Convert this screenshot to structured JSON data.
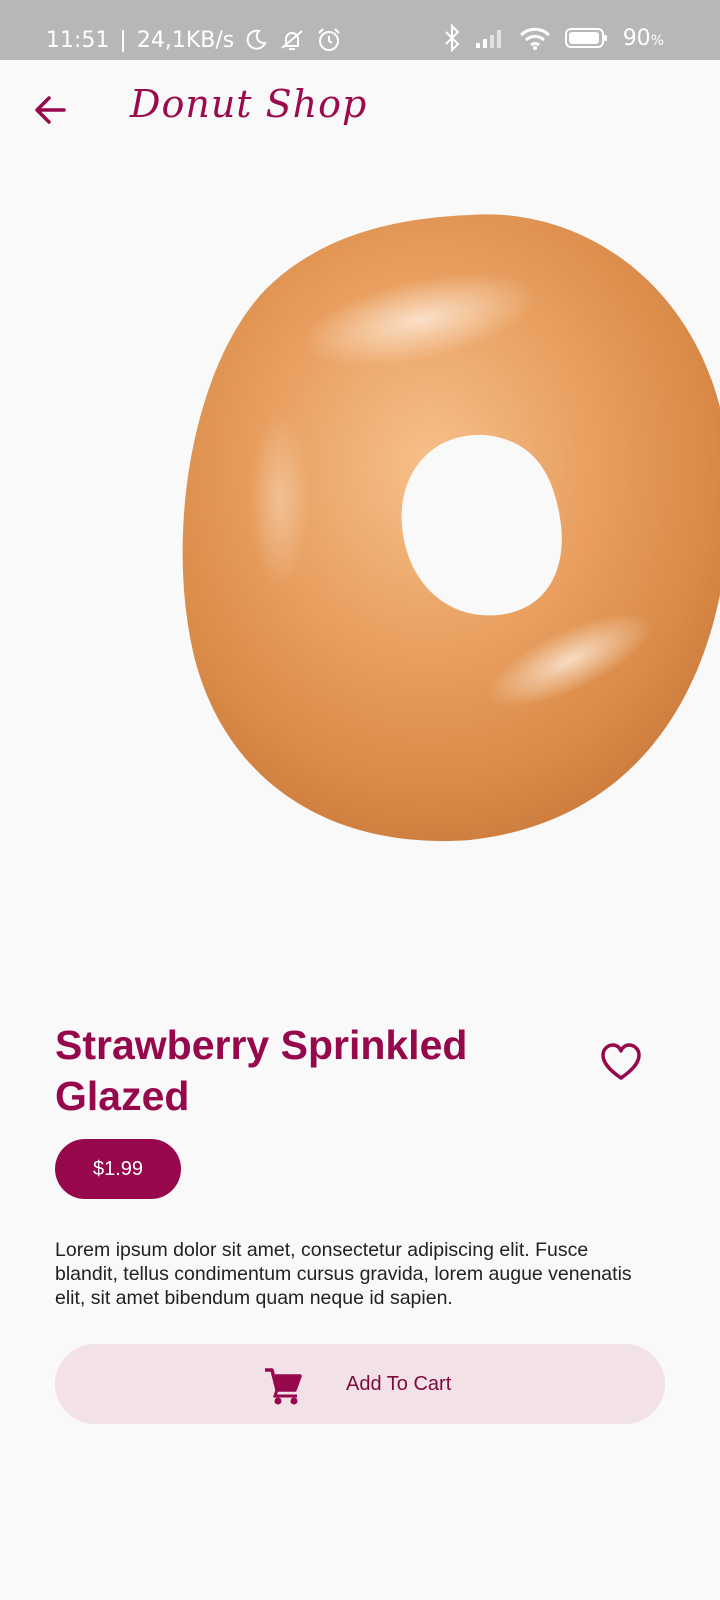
{
  "status_bar": {
    "time": "11:51",
    "network_speed": "24,1KB/s",
    "battery_percent": "90",
    "battery_unit": "%",
    "icons": [
      "moon-icon",
      "mute-icon",
      "alarm-icon",
      "bluetooth-icon",
      "signal-icon",
      "wifi-icon",
      "battery-icon"
    ]
  },
  "app_bar": {
    "title": "Donut Shop",
    "back_icon": "arrow-left-icon"
  },
  "product": {
    "name": "Strawberry Sprinkled Glazed",
    "price": "$1.99",
    "description": "Lorem ipsum dolor sit amet, consectetur adipiscing elit. Fusce blandit, tellus condimentum cursus gravida, lorem augue venenatis elit, sit amet bibendum quam neque id sapien.",
    "favorite_icon": "heart-outline-icon"
  },
  "actions": {
    "add_to_cart_label": "Add To Cart",
    "cart_icon": "shopping-cart-icon"
  },
  "colors": {
    "brand": "#96084b",
    "button_bg": "#f2e1e7",
    "background": "#f9f9fa",
    "status_bar": "#b7b7b7"
  }
}
